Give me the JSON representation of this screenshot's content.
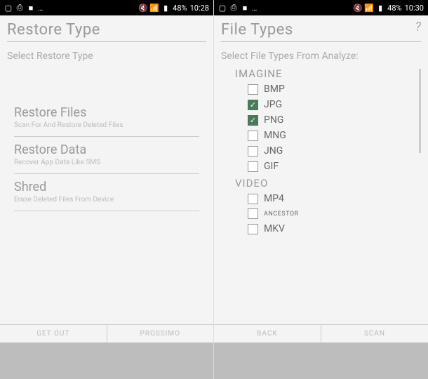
{
  "left": {
    "status": {
      "battery": "48%",
      "time": "10:28"
    },
    "title": "Restore Type",
    "subtitle": "Select Restore Type",
    "options": [
      {
        "title": "Restore Files",
        "desc": "Scan For And Restore Deleted Files"
      },
      {
        "title": "Restore Data",
        "desc": "Recover App Data Like SMS"
      },
      {
        "title": "Shred",
        "desc": "Erase Deleted Files From Device"
      }
    ],
    "footer": {
      "left": "GET OUT",
      "right": "PROSSIMO"
    }
  },
  "right": {
    "status": {
      "battery": "48%",
      "time": "10:30"
    },
    "title": "File Types",
    "subtitle": "Select File Types From Analyze:",
    "groups": [
      {
        "label": "IMAGINE",
        "items": [
          {
            "label": "BMP",
            "checked": false
          },
          {
            "label": "JPG",
            "checked": true
          },
          {
            "label": "PNG",
            "checked": true
          },
          {
            "label": "MNG",
            "checked": false
          },
          {
            "label": "JNG",
            "checked": false
          },
          {
            "label": "GIF",
            "checked": false
          }
        ]
      },
      {
        "label": "VIDEO",
        "items": [
          {
            "label": "MP4",
            "checked": false
          },
          {
            "label": "ANCESTOR",
            "checked": false,
            "small": true
          },
          {
            "label": "MKV",
            "checked": false
          }
        ]
      }
    ],
    "footer": {
      "left": "BACK",
      "right": "SCAN"
    }
  }
}
